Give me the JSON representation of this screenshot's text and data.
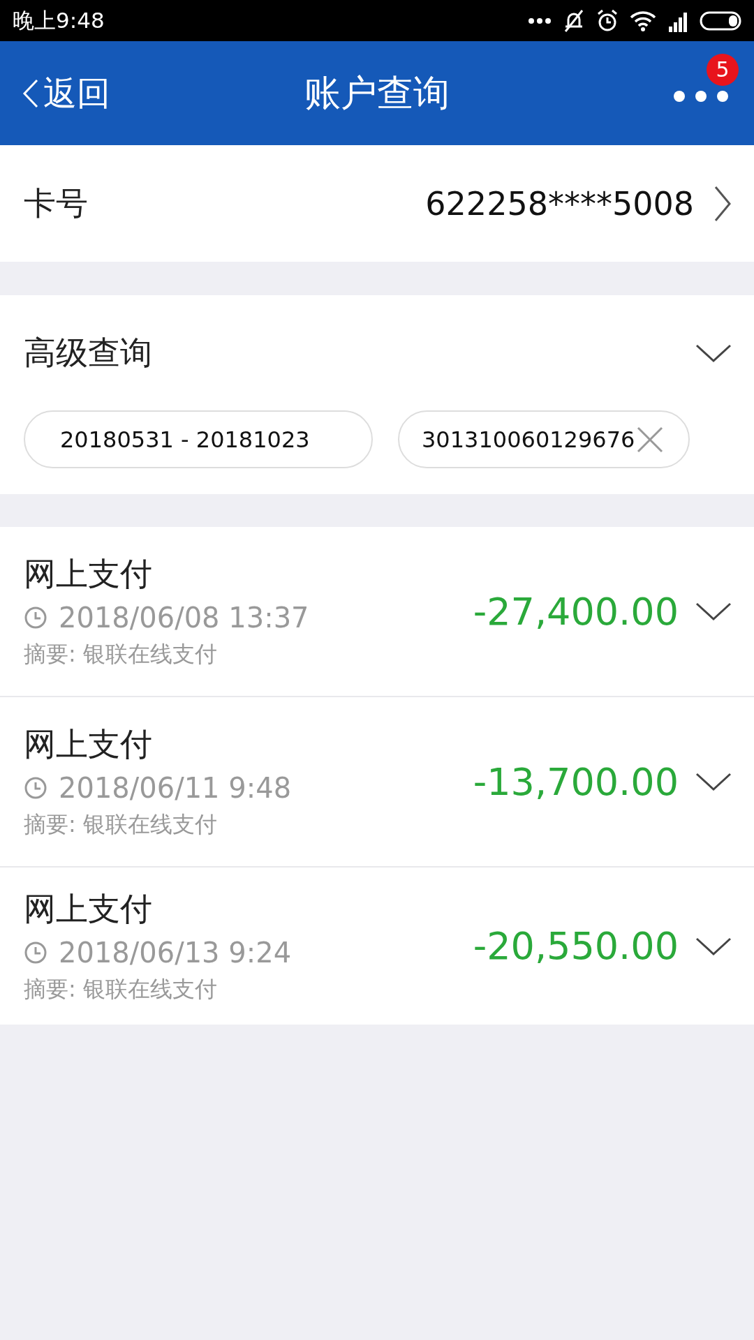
{
  "status_bar": {
    "time": "晚上9:48"
  },
  "header": {
    "back": "返回",
    "title": "账户查询",
    "badge": "5"
  },
  "card": {
    "label": "卡号",
    "number": "622258****5008"
  },
  "advanced": {
    "title": "高级查询",
    "expanded": false,
    "filters": [
      {
        "text": "20180531 - 20181023",
        "clearable": false
      },
      {
        "text": "301310060129676",
        "clearable": true
      }
    ]
  },
  "transactions": [
    {
      "title": "网上支付",
      "time": "2018/06/08 13:37",
      "amount": "-27,400.00",
      "summary": "摘要: 银联在线支付"
    },
    {
      "title": "网上支付",
      "time": "2018/06/11 9:48",
      "amount": "-13,700.00",
      "summary": "摘要: 银联在线支付"
    },
    {
      "title": "网上支付",
      "time": "2018/06/13 9:24",
      "amount": "-20,550.00",
      "summary": "摘要: 银联在线支付"
    }
  ]
}
